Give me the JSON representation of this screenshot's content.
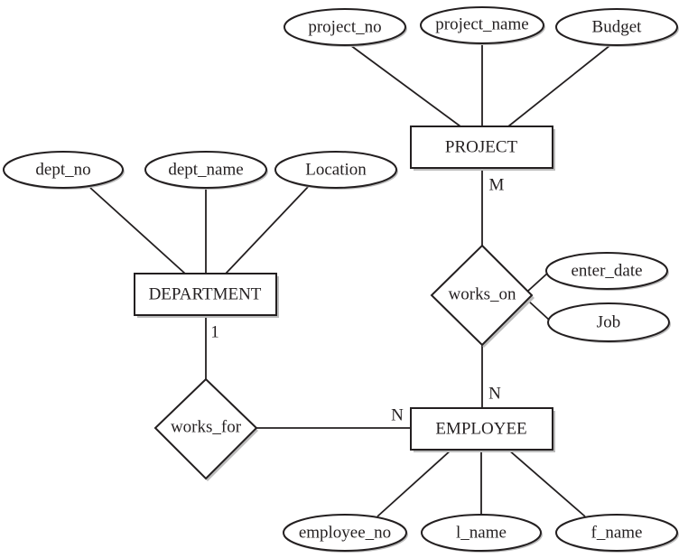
{
  "entities": {
    "project": "PROJECT",
    "department": "DEPARTMENT",
    "employee": "EMPLOYEE"
  },
  "relationships": {
    "works_on": "works_on",
    "works_for": "works_for"
  },
  "attributes": {
    "project_no": "project_no",
    "project_name": "project_name",
    "budget": "Budget",
    "dept_no": "dept_no",
    "dept_name": "dept_name",
    "location": "Location",
    "enter_date": "enter_date",
    "job": "Job",
    "employee_no": "employee_no",
    "l_name": "l_name",
    "f_name": "f_name"
  },
  "cardinalities": {
    "project_works_on": "M",
    "employee_works_on": "N",
    "department_works_for": "1",
    "employee_works_for": "N"
  }
}
